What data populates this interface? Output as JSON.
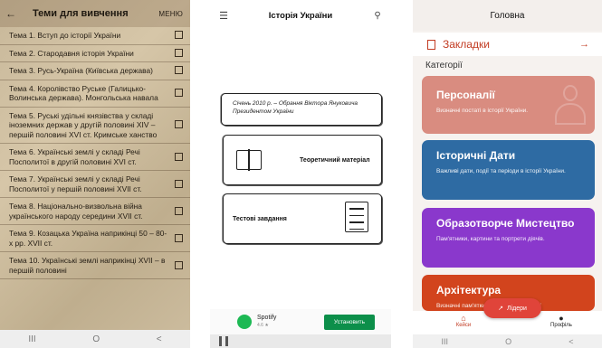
{
  "screen1": {
    "title": "Теми для вивчення",
    "menu_label": "МЕНЮ",
    "back_icon": "←",
    "topics": [
      "Тема 1. Вступ до історії України",
      "Тема 2. Стародавня історія України",
      "Тема 3. Русь-Україна (Київська держава)",
      "Тема 4. Королівство Руське (Галицько-Волинська держава). Монгольська навала",
      "Тема 5. Руські удільні князівства у складі іноземних держав у другій половині XIV – першій половині XVI ст. Кримське ханство",
      "Тема 6. Українські землі у складі Речі Посполитої в другій половині XVI ст.",
      "Тема 7. Українські землі у складі Речі Посполитої у першій половині XVII ст.",
      "Тема 8. Національно-визвольна війна українського народу середини XVII ст.",
      "Тема 9. Козацька Україна наприкінці 50 – 80-х рр. XVII ст.",
      "Тема 10. Українські землі наприкінці XVII – в першій половині"
    ],
    "nav": [
      "III",
      "O",
      "<"
    ]
  },
  "screen2": {
    "title": "Історія України",
    "quote": "Січень 2010 р. – Обрання Віктора Януковича Президентом України",
    "theory_label": "Теоретичний матеріал",
    "tests_label": "Тестові завдання",
    "ad": {
      "app_name": "Spotify",
      "rating": "4.6 ★",
      "install_label": "Установить"
    }
  },
  "screen3": {
    "header": "Головна",
    "bookmarks_label": "Закладки",
    "bookmarks_arrow": "→",
    "categories_label": "Категорії",
    "categories": [
      {
        "title": "Персоналії",
        "desc": "Визначні постаті в історії України."
      },
      {
        "title": "Історичні Дати",
        "desc": "Важливі дати, події та періоди в історії України."
      },
      {
        "title": "Образотворче Мистецтво",
        "desc": "Пам'ятники, картини та портрети діячів."
      },
      {
        "title": "Архітектура",
        "desc": "Визначні пам'ятки архітектури в історії"
      }
    ],
    "tab_cases": "Кейси",
    "tab_profile": "Профіль",
    "fab_label": "Лідери",
    "nav": [
      "III",
      "O",
      "<"
    ]
  },
  "colors": {
    "accent_red": "#c23b22",
    "personalities": "#d98c80",
    "dates": "#2e6ba3",
    "art": "#8a38cc",
    "architecture": "#d2441d",
    "spotify_green": "#1db954"
  }
}
